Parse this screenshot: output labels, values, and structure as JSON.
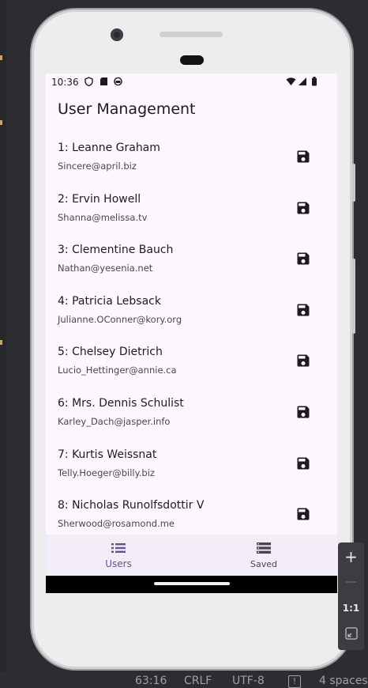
{
  "status_bar": {
    "time": "10:36"
  },
  "app_bar": {
    "title": "User Management"
  },
  "users": [
    {
      "name": "1: Leanne Graham",
      "email": "Sincere@april.biz"
    },
    {
      "name": "2: Ervin Howell",
      "email": "Shanna@melissa.tv"
    },
    {
      "name": "3: Clementine Bauch",
      "email": "Nathan@yesenia.net"
    },
    {
      "name": "4: Patricia Lebsack",
      "email": "Julianne.OConner@kory.org"
    },
    {
      "name": "5: Chelsey Dietrich",
      "email": "Lucio_Hettinger@annie.ca"
    },
    {
      "name": "6: Mrs. Dennis Schulist",
      "email": "Karley_Dach@jasper.info"
    },
    {
      "name": "7: Kurtis Weissnat",
      "email": "Telly.Hoeger@billy.biz"
    },
    {
      "name": "8: Nicholas Runolfsdottir V",
      "email": "Sherwood@rosamond.me"
    }
  ],
  "row_action_icon": "save-icon",
  "bottom_nav": {
    "items": [
      {
        "label": "Users",
        "icon": "list-icon",
        "selected": true
      },
      {
        "label": "Saved",
        "icon": "storage-icon",
        "selected": false
      }
    ]
  },
  "emulator_panel": {
    "zoom_in": "+",
    "zoom_out": "—",
    "actual_size": "1:1"
  },
  "ide_status_bar": {
    "position": "63:16",
    "line_ending": "CRLF",
    "encoding": "UTF-8",
    "indent": "4 spaces"
  },
  "colors": {
    "screen_bg": "#fef7ff",
    "accent": "#65558f",
    "nav_bg": "#f3edf7",
    "text": "#1d1b20",
    "subtext": "#49454f"
  }
}
